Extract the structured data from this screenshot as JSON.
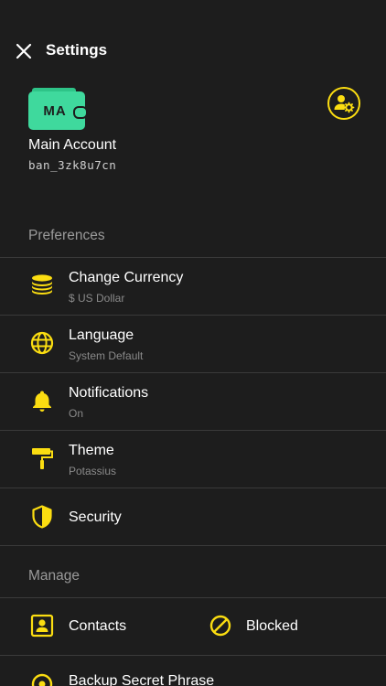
{
  "header": {
    "title": "Settings"
  },
  "account": {
    "initials": "MA",
    "name": "Main Account",
    "address": "ban_3zk8u7cn"
  },
  "sections": {
    "preferences": "Preferences",
    "manage": "Manage"
  },
  "preferences": [
    {
      "label": "Change Currency",
      "sub": "$ US Dollar",
      "icon": "coins-icon"
    },
    {
      "label": "Language",
      "sub": "System Default",
      "icon": "globe-icon"
    },
    {
      "label": "Notifications",
      "sub": "On",
      "icon": "bell-icon"
    },
    {
      "label": "Theme",
      "sub": "Potassius",
      "icon": "paint-roller-icon"
    },
    {
      "label": "Security",
      "sub": "",
      "icon": "shield-icon"
    }
  ],
  "manage": {
    "contacts": "Contacts",
    "blocked": "Blocked",
    "backup": "Backup Secret Phrase"
  },
  "colors": {
    "background": "#1d1d1d",
    "accent": "#fbdd11",
    "wallet": "#3fd99d",
    "divider": "#3a3a3a",
    "subtext": "#8a8a8a"
  }
}
